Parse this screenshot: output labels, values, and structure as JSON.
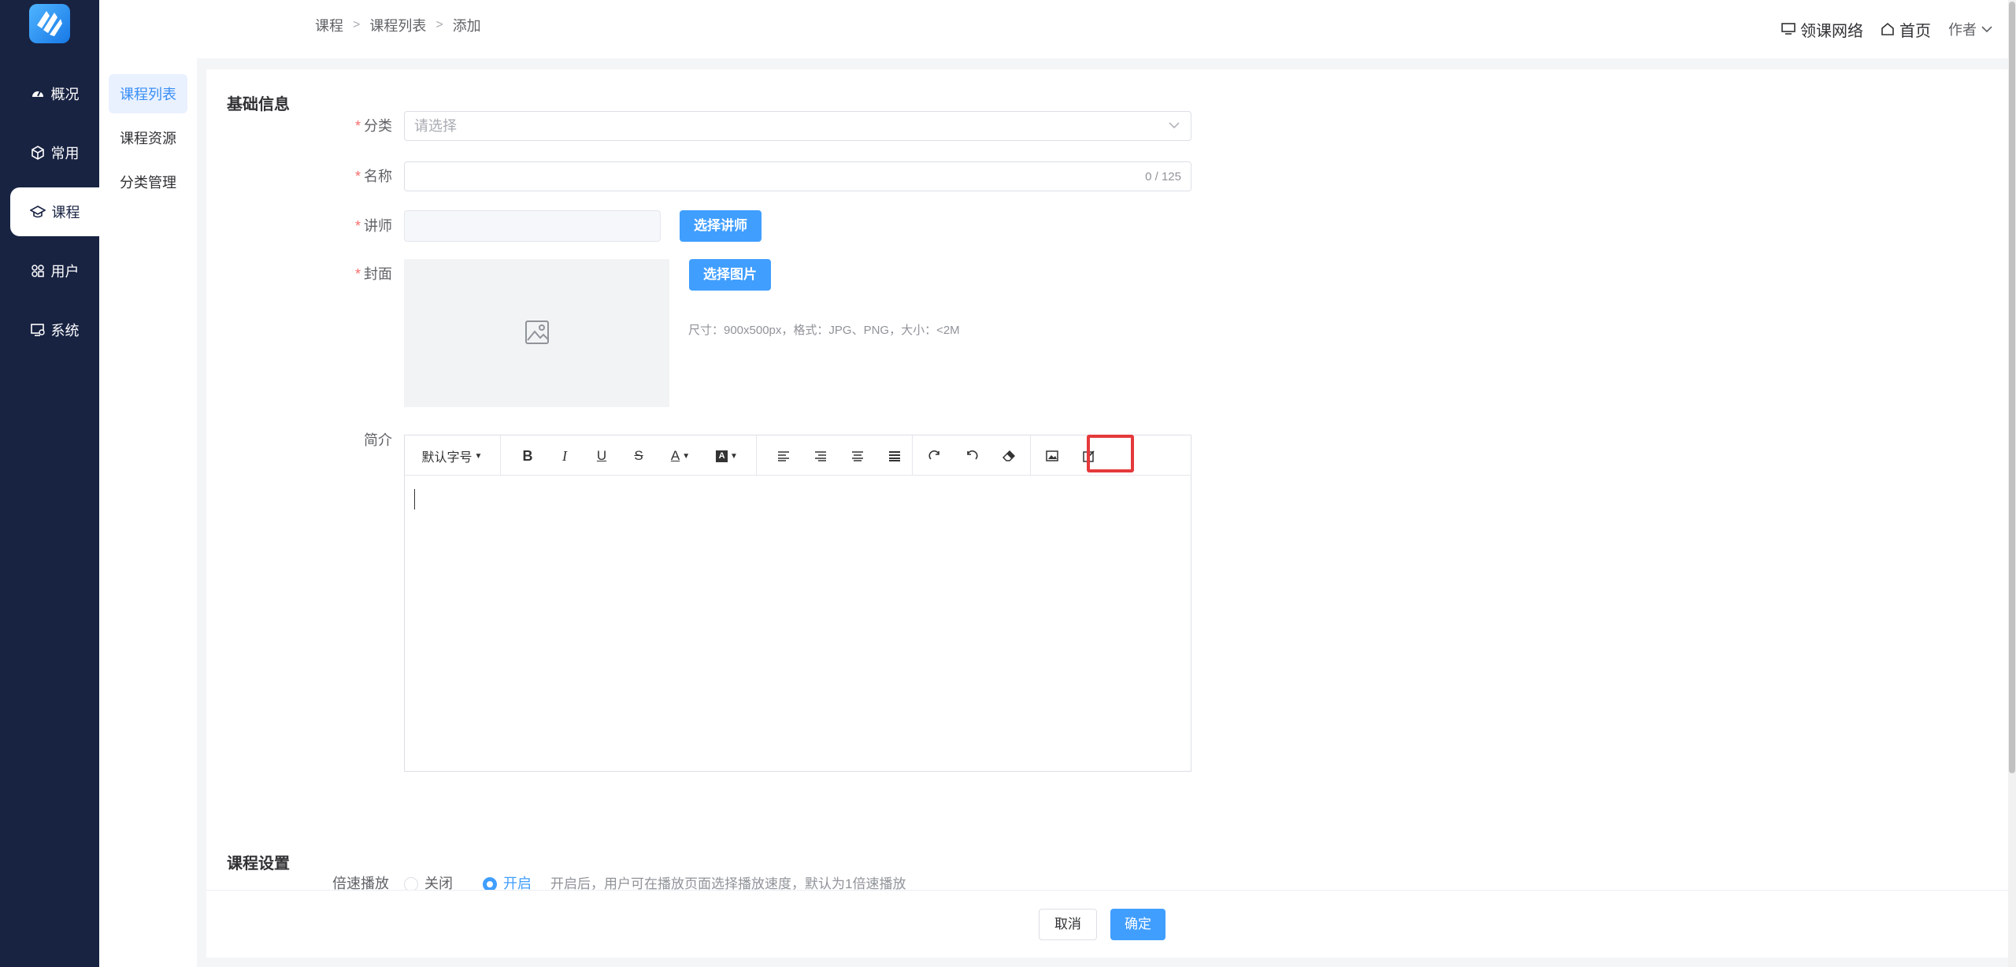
{
  "nav": {
    "items": [
      {
        "label": "概况",
        "icon": "dashboard-icon"
      },
      {
        "label": "常用",
        "icon": "cube-icon"
      },
      {
        "label": "课程",
        "icon": "graduation-cap-icon"
      },
      {
        "label": "用户",
        "icon": "users-icon"
      },
      {
        "label": "系统",
        "icon": "monitor-settings-icon"
      }
    ],
    "active": "课程"
  },
  "subnav": {
    "items": [
      "课程列表",
      "课程资源",
      "分类管理"
    ],
    "active": "课程列表"
  },
  "breadcrumb": [
    "课程",
    "课程列表",
    "添加"
  ],
  "header": {
    "site_label": "领课网络",
    "home_label": "首页",
    "author_label": "作者"
  },
  "form": {
    "section_basic": "基础信息",
    "category": {
      "label": "分类",
      "placeholder": "请选择"
    },
    "name": {
      "label": "名称",
      "value": "",
      "counter": "0 / 125"
    },
    "teacher": {
      "label": "讲师",
      "button": "选择讲师"
    },
    "cover": {
      "label": "封面",
      "button": "选择图片",
      "hint": "尺寸：900x500px，格式：JPG、PNG，大小：<2M"
    },
    "intro": {
      "label": "简介"
    },
    "section_settings": "课程设置",
    "speed": {
      "label": "倍速播放",
      "off": "关闭",
      "on": "开启",
      "selected": "开启",
      "hint": "开启后，用户可在播放页面选择播放速度，默认为1倍速播放"
    }
  },
  "editor": {
    "font_size_label": "默认字号",
    "tools": [
      "bold-icon",
      "italic-icon",
      "underline-icon",
      "strikethrough-icon",
      "font-color-icon",
      "background-color-icon",
      "align-left-icon",
      "align-right-icon",
      "align-center-icon",
      "align-justify-icon",
      "redo-icon",
      "undo-icon",
      "eraser-icon",
      "image-icon",
      "edit-source-icon"
    ],
    "highlighted_tool": "edit-source-icon"
  },
  "footer": {
    "cancel": "取消",
    "confirm": "确定"
  },
  "colors": {
    "nav_bg": "#182342",
    "primary": "#409eff",
    "highlight": "#e5393b"
  }
}
